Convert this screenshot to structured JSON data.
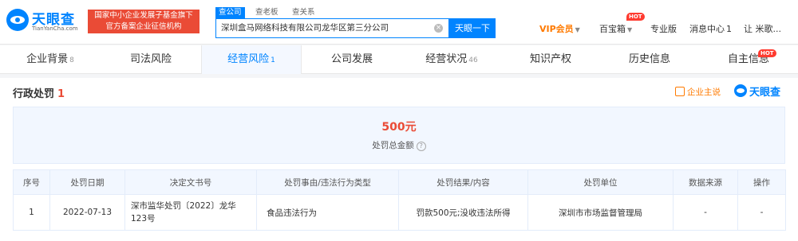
{
  "brand": {
    "name_cn": "天眼查",
    "name_en": "TianYanCha.com",
    "slogan_line1": "国家中小企业发展子基金旗下",
    "slogan_line2": "官方备案企业征信机构"
  },
  "search": {
    "tabs": [
      "查公司",
      "查老板",
      "查关系"
    ],
    "active_tab": 0,
    "value": "深圳盒马网络科技有限公司龙华区第三分公司",
    "button_label": "天眼一下",
    "clear_symbol": "×"
  },
  "header_nav": {
    "vip": "VIP会员",
    "toolbox": "百宝箱",
    "hot_badge": "HOT",
    "pro": "专业版",
    "messages": "消息中心",
    "messages_count": "1",
    "user": "让 米歌..."
  },
  "tabs": [
    {
      "label": "企业背景",
      "count": "8"
    },
    {
      "label": "司法风险",
      "count": ""
    },
    {
      "label": "经营风险",
      "count": "1"
    },
    {
      "label": "公司发展",
      "count": ""
    },
    {
      "label": "经营状况",
      "count": "46"
    },
    {
      "label": "知识产权",
      "count": ""
    },
    {
      "label": "历史信息",
      "count": ""
    },
    {
      "label": "自主信息",
      "count": ""
    }
  ],
  "active_tab": 2,
  "section": {
    "title": "行政处罚",
    "count": "1",
    "owner_link": "企业主说",
    "brand_text": "天眼查"
  },
  "summary": {
    "amount": "500元",
    "label": "处罚总金额",
    "help_symbol": "?"
  },
  "table": {
    "headers": [
      "序号",
      "处罚日期",
      "决定文书号",
      "处罚事由/违法行为类型",
      "处罚结果/内容",
      "处罚单位",
      "数据来源",
      "操作"
    ],
    "rows": [
      {
        "index": "1",
        "date": "2022-07-13",
        "doc_no": "深市监华处罚〔2022〕龙华123号",
        "reason": "食品违法行为",
        "result": "罚款500元;没收违法所得",
        "authority": "深圳市市场监督管理局",
        "source": "-",
        "action": "-"
      }
    ]
  },
  "colors": {
    "accent": "#0084ff",
    "danger": "#ea4b36",
    "vip": "#ff7a00"
  }
}
